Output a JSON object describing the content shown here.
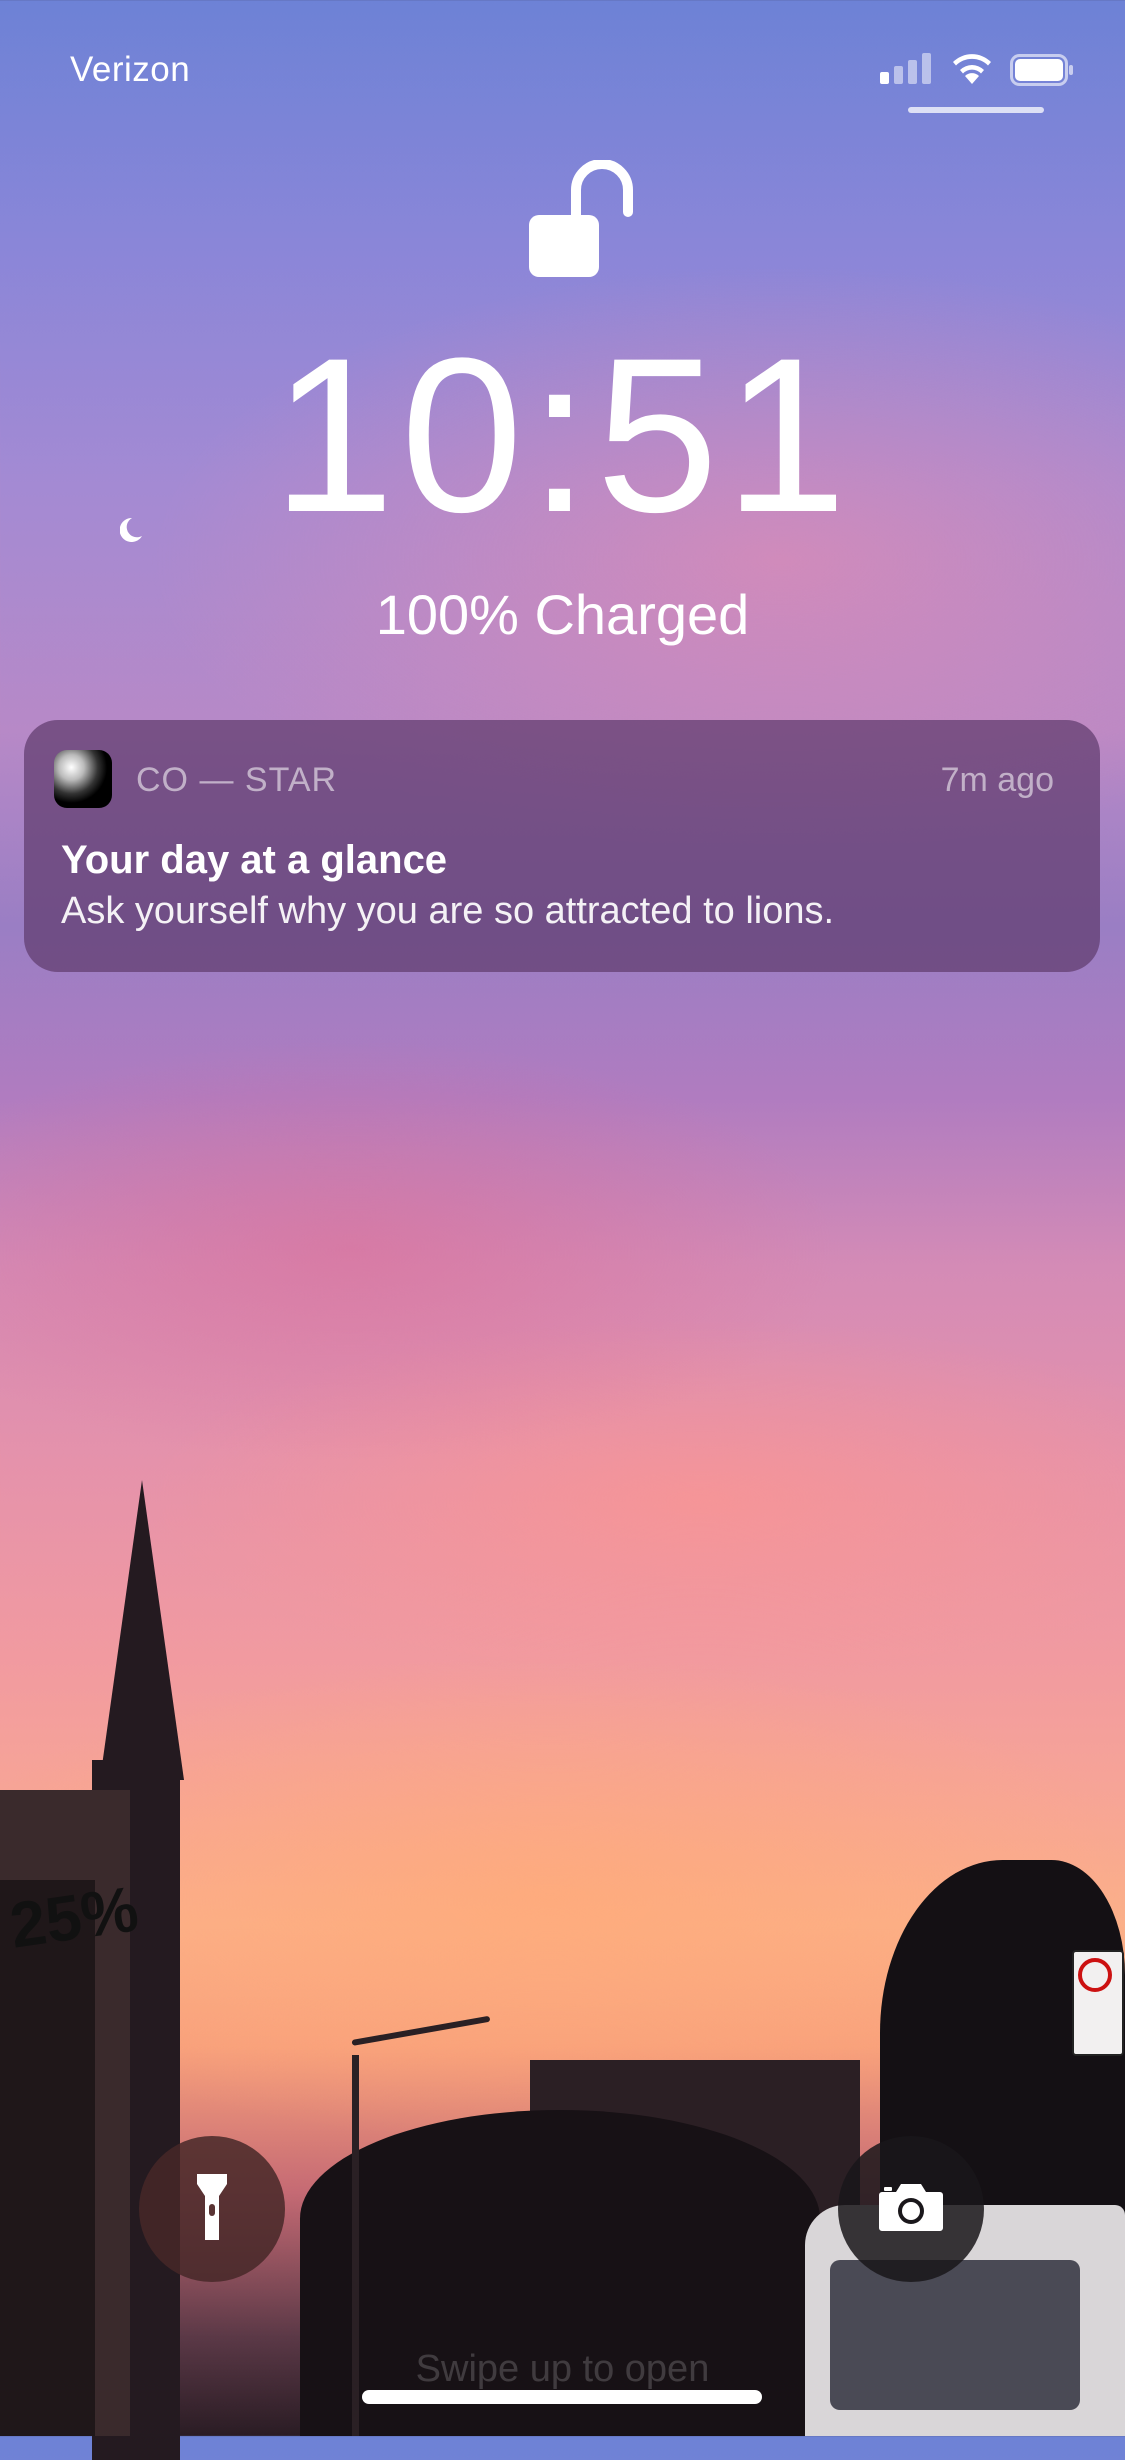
{
  "status_bar": {
    "carrier": "Verizon",
    "signal_bars_on": 1,
    "signal_bars_total": 4,
    "battery_level": 1.0
  },
  "lock_screen": {
    "time": "10:51",
    "charge_status": "100% Charged"
  },
  "notification": {
    "app_name": "CO — STAR",
    "time_ago": "7m ago",
    "title": "Your day at a glance",
    "body": "Ask yourself why you are so attracted to lions."
  },
  "bottom": {
    "swipe_hint": "Swipe up to open"
  },
  "wallpaper": {
    "mural_text": "25%"
  },
  "colors": {
    "notification_bg": "#5f3c6e",
    "flashlight_bg": "#462828",
    "camera_bg": "#19161a"
  },
  "icons": {
    "lock": "unlocked-padlock-icon",
    "flashlight": "flashlight-icon",
    "camera": "camera-icon",
    "wifi": "wifi-icon",
    "battery": "battery-icon",
    "signal": "signal-icon",
    "app": "co-star-app-icon"
  }
}
